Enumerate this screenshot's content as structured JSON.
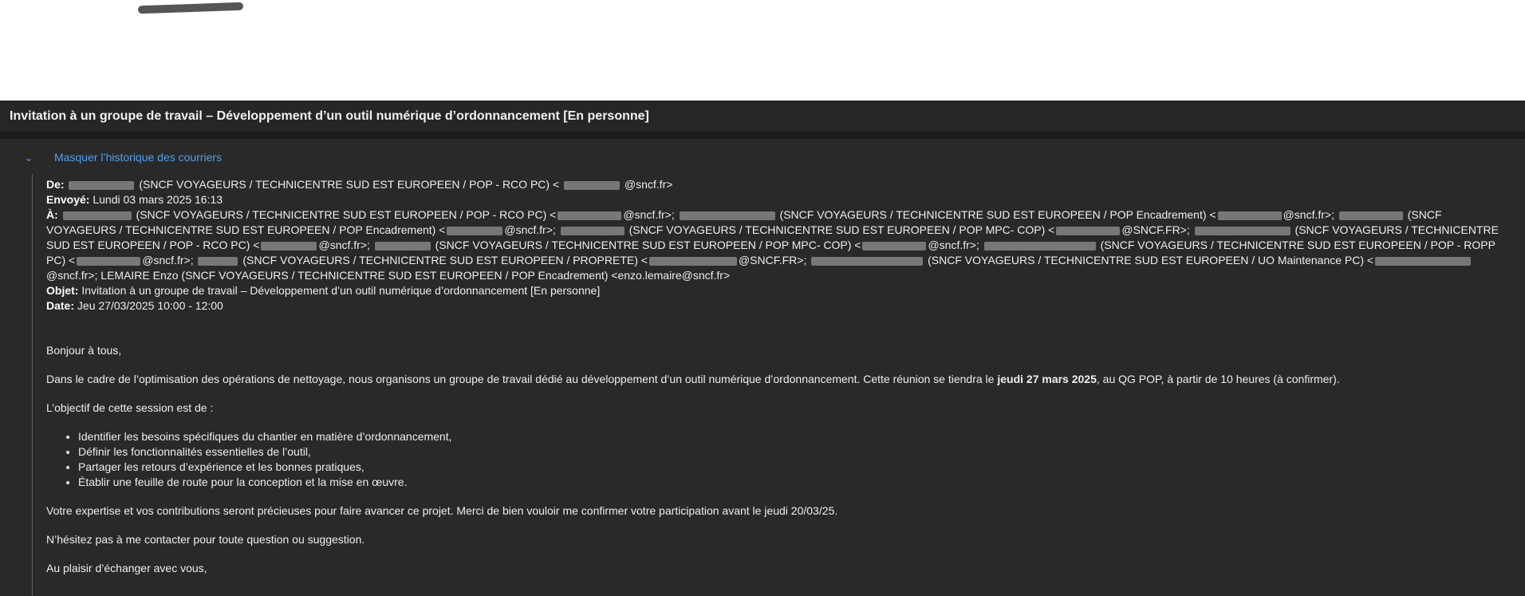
{
  "subject_bar": {
    "title": "Invitation à un groupe de travail – Développement d’un outil numérique d’ordonnancement [En personne]"
  },
  "history_toggle": {
    "label": "Masquer l’historique des courriers",
    "icon": "chevron-down-icon"
  },
  "header": {
    "from_label": "De:",
    "from_org": " (SNCF VOYAGEURS / TECHNICENTRE SUD EST EUROPEEN / POP - RCO PC) <",
    "from_domain": "@sncf.fr>",
    "sent_label": "Envoyé:",
    "sent_value": " Lundi 03 mars 2025 16:13",
    "to_label": "À:",
    "to_p1": " (SNCF VOYAGEURS / TECHNICENTRE SUD EST EUROPEEN / POP - RCO PC) <",
    "to_p2": "@sncf.fr>; ",
    "to_p3": " (SNCF VOYAGEURS / TECHNICENTRE SUD EST EUROPEEN / POP Encadrement) <",
    "to_p4": "@sncf.fr>; ",
    "to_p5": " (SNCF VOYAGEURS / TECHNICENTRE SUD EST EUROPEEN / POP Encadrement) <",
    "to_p6": "@sncf.fr>; ",
    "to_p7": " (SNCF VOYAGEURS / TECHNICENTRE SUD EST EUROPEEN / POP MPC- COP) <",
    "to_p8": "@SNCF.FR>; ",
    "to_p9": " (SNCF VOYAGEURS / TECHNICENTRE SUD EST EUROPEEN / POP - RCO PC) <",
    "to_p10": "@sncf.fr>; ",
    "to_p11": " (SNCF VOYAGEURS / TECHNICENTRE SUD EST EUROPEEN / POP MPC- COP) <",
    "to_p12": "@sncf.fr>; ",
    "to_p13": " (SNCF VOYAGEURS / TECHNICENTRE SUD EST EUROPEEN / POP - ROPP PC) <",
    "to_p14": "@sncf.fr>; ",
    "to_p15": " (SNCF VOYAGEURS / TECHNICENTRE SUD EST EUROPEEN / PROPRETE) <",
    "to_p16": "@SNCF.FR>; ",
    "to_p17": " (SNCF VOYAGEURS / TECHNICENTRE SUD EST EUROPEEN / UO Maintenance PC) <",
    "to_p18": "@sncf.fr>; LEMAIRE Enzo (SNCF VOYAGEURS / TECHNICENTRE SUD EST EUROPEEN / POP Encadrement) <enzo.lemaire@sncf.fr>",
    "subject_label": "Objet:",
    "subject_value": " Invitation à un groupe de travail – Développement d’un outil numérique d’ordonnancement [En personne]",
    "date_label": "Date:",
    "date_value": " Jeu 27/03/2025 10:00 - 12:00"
  },
  "body": {
    "greeting": "Bonjour à tous,",
    "para1_a": "Dans le cadre de l’optimisation des opérations de nettoyage, nous organisons un groupe de travail dédié au développement d’un outil numérique d’ordonnancement. Cette réunion se tiendra le ",
    "para1_bold": "jeudi 27 mars 2025",
    "para1_b": ", au QG POP, à partir de 10 heures (à confirmer).",
    "objective_intro": "L’objectif de cette session est de :",
    "bullets": [
      "Identifier les besoins spécifiques du chantier en matière d’ordonnancement,",
      "Définir les fonctionnalités essentielles de l’outil,",
      "Partager les retours d’expérience et les bonnes pratiques,",
      "Établir une feuille de route pour la conception et la mise en œuvre."
    ],
    "para3": "Votre expertise et vos contributions seront précieuses pour faire avancer ce projet. Merci de bien vouloir me confirmer votre participation avant le jeudi 20/03/25.",
    "para4": "N’hésitez pas à me contacter pour toute question ou suggestion.",
    "closing": "Au plaisir d’échanger avec vous,"
  },
  "colors": {
    "panel_bg": "#292929",
    "subject_bar_bg": "#262626",
    "link": "#4ea0ee",
    "text": "#eeeeee"
  }
}
